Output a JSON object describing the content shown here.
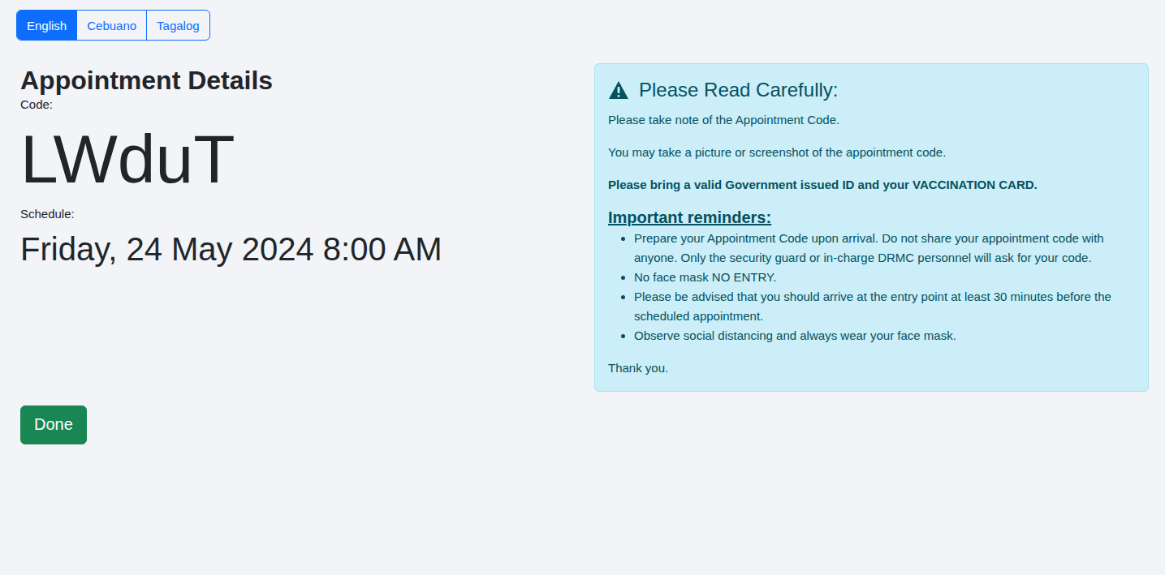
{
  "language_tabs": [
    {
      "label": "English",
      "selected": true
    },
    {
      "label": "Cebuano",
      "selected": false
    },
    {
      "label": "Tagalog",
      "selected": false
    }
  ],
  "details": {
    "title": "Appointment Details",
    "code_label": "Code:",
    "code": "LWduT",
    "schedule_label": "Schedule:",
    "schedule": "Friday, 24 May 2024 8:00 AM"
  },
  "notice": {
    "title": "Please Read Carefully:",
    "paragraphs": [
      "Please take note of the Appointment Code.",
      "You may take a picture or screenshot of the appointment code."
    ],
    "emphasis": "Please bring a valid Government issued ID and your VACCINATION CARD.",
    "reminders_title": "Important reminders:",
    "reminders": [
      "Prepare your Appointment Code upon arrival. Do not share your appointment code with anyone. Only the security guard or in-charge DRMC personnel will ask for your code.",
      "No face mask NO ENTRY.",
      "Please be advised that you should arrive at the entry point at least 30 minutes before the scheduled appointment.",
      "Observe social distancing and always wear your face mask."
    ],
    "closing": "Thank you."
  },
  "buttons": [
    "Done"
  ]
}
